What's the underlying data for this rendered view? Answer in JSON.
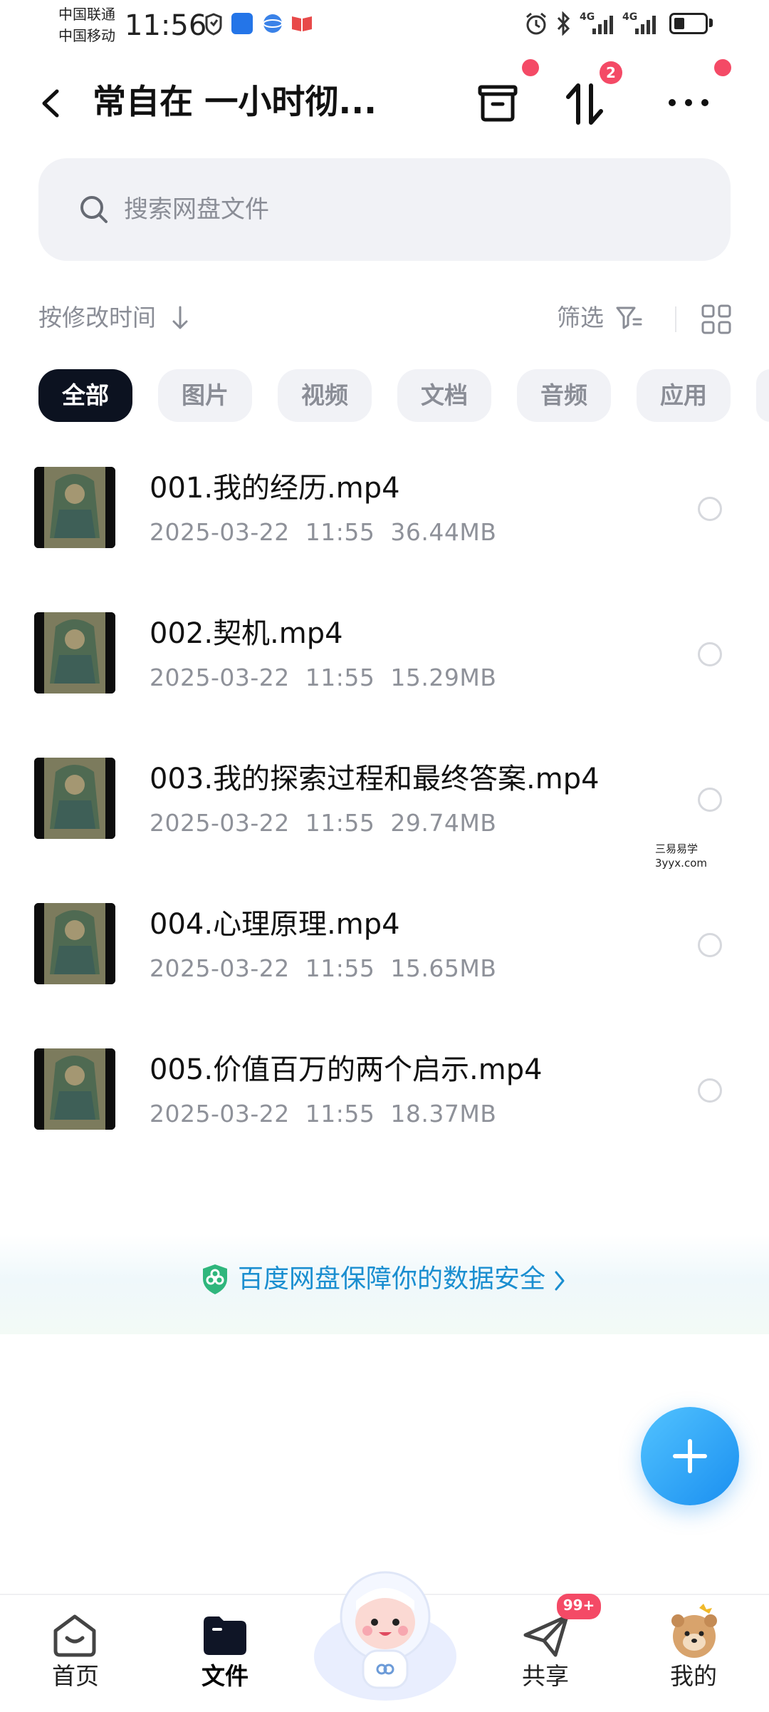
{
  "status_bar": {
    "carrier_1": "中国联通",
    "carrier_2": "中国移动",
    "time": "11:56",
    "signal_1": "4G",
    "signal_2": "4G",
    "battery_level_fraction": 0.35
  },
  "header": {
    "title": "常自在 一小时彻...",
    "transfer_badge": "2"
  },
  "search": {
    "placeholder": "搜索网盘文件"
  },
  "toolbar": {
    "sort_label": "按修改时间",
    "filter_label": "筛选"
  },
  "categories": [
    {
      "label": "全部",
      "active": true
    },
    {
      "label": "图片",
      "active": false
    },
    {
      "label": "视频",
      "active": false
    },
    {
      "label": "文档",
      "active": false
    },
    {
      "label": "音频",
      "active": false
    },
    {
      "label": "应用",
      "active": false
    }
  ],
  "files": [
    {
      "name": "001.我的经历.mp4",
      "date": "2025-03-22",
      "time": "11:55",
      "size": "36.44MB"
    },
    {
      "name": "002.契机.mp4",
      "date": "2025-03-22",
      "time": "11:55",
      "size": "15.29MB"
    },
    {
      "name": "003.我的探索过程和最终答案.mp4",
      "date": "2025-03-22",
      "time": "11:55",
      "size": "29.74MB"
    },
    {
      "name": "004.心理原理.mp4",
      "date": "2025-03-22",
      "time": "11:55",
      "size": "15.65MB"
    },
    {
      "name": "005.价值百万的两个启示.mp4",
      "date": "2025-03-22",
      "time": "11:55",
      "size": "18.37MB"
    }
  ],
  "watermark": {
    "line_1": "三易易学",
    "line_2": "3yyx.com"
  },
  "banner": {
    "text": "百度网盘保障你的数据安全"
  },
  "bottom_nav": {
    "home": "首页",
    "files": "文件",
    "share": "共享",
    "share_badge": "99+",
    "mine": "我的"
  },
  "colors": {
    "accent": "#1a8ed0",
    "badge": "#f44a66",
    "chip_active": "#0c1220"
  }
}
